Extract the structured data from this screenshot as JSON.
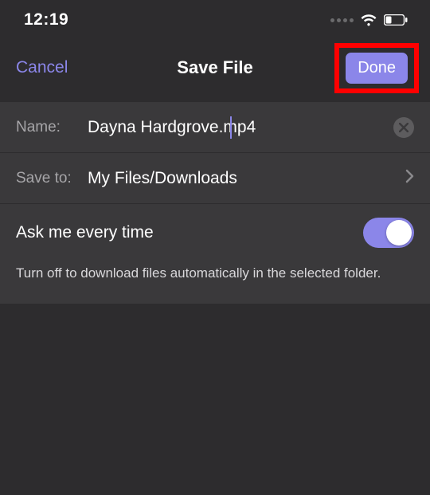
{
  "status": {
    "time": "12:19"
  },
  "nav": {
    "cancel": "Cancel",
    "title": "Save File",
    "done": "Done"
  },
  "nameRow": {
    "label": "Name:",
    "value": "Dayna Hardgrove.mp4"
  },
  "saveTo": {
    "label": "Save to:",
    "value": "My Files/Downloads"
  },
  "ask": {
    "label": "Ask me every time",
    "on": true,
    "hint": "Turn off to download files automatically in the selected folder."
  },
  "colors": {
    "accent": "#8b86e9",
    "highlight": "#ff0000"
  }
}
